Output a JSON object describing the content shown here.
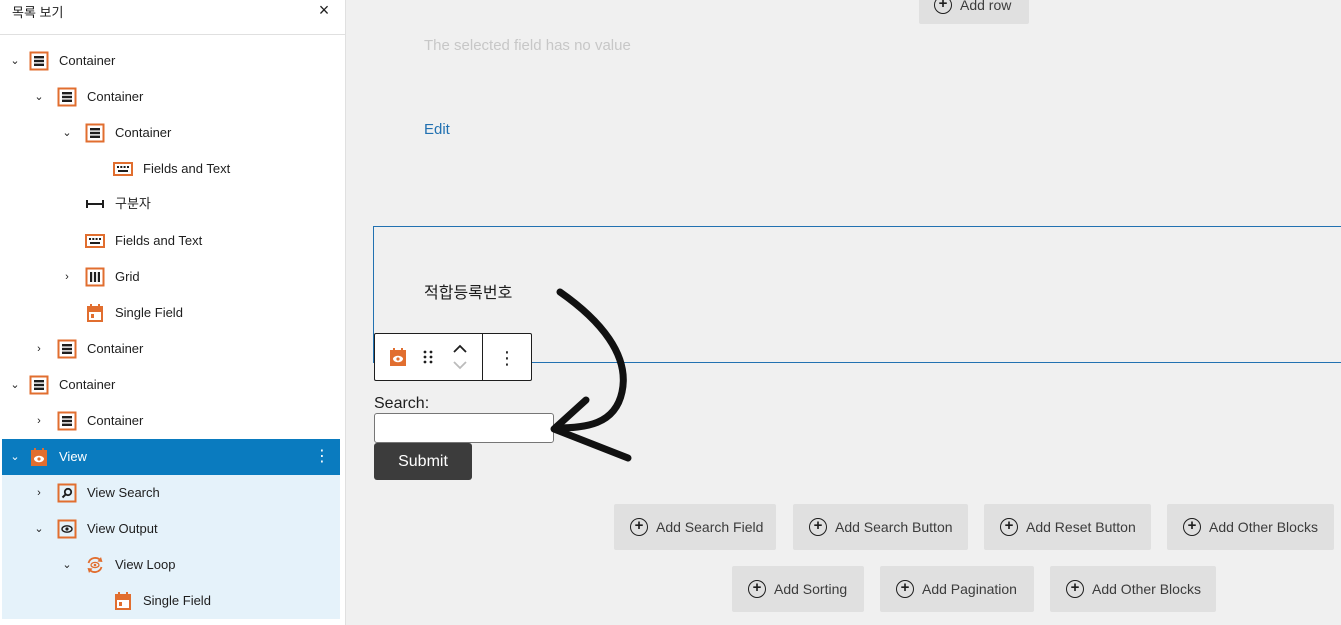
{
  "sidebar": {
    "title": "목록 보기",
    "close_label": "×",
    "items": [
      {
        "label": "Container",
        "icon": "container-icon"
      },
      {
        "label": "Container",
        "icon": "container-icon"
      },
      {
        "label": "Container",
        "icon": "container-icon"
      },
      {
        "label": "Fields and Text",
        "icon": "keyboard-icon"
      },
      {
        "label": "구분자",
        "icon": "separator-icon"
      },
      {
        "label": "Fields and Text",
        "icon": "keyboard-icon"
      },
      {
        "label": "Grid",
        "icon": "grid-icon"
      },
      {
        "label": "Single Field",
        "icon": "calendar-icon"
      },
      {
        "label": "Container",
        "icon": "container-icon"
      },
      {
        "label": "Container",
        "icon": "container-icon"
      },
      {
        "label": "Container",
        "icon": "container-icon"
      },
      {
        "label": "View",
        "icon": "view-icon",
        "selected": true
      },
      {
        "label": "View Search",
        "icon": "search-icon"
      },
      {
        "label": "View Output",
        "icon": "eye-icon"
      },
      {
        "label": "View Loop",
        "icon": "loop-icon"
      },
      {
        "label": "Single Field",
        "icon": "calendar-icon"
      }
    ]
  },
  "main": {
    "add_row_label": "Add row",
    "no_value_text": "The selected field has no value",
    "edit_label": "Edit",
    "block_text": "적합등록번호",
    "search_label": "Search:",
    "search_value": "",
    "submit_label": "Submit",
    "buttons_row1": [
      "Add Search Field",
      "Add Search Button",
      "Add Reset Button",
      "Add Other Blocks"
    ],
    "buttons_row2": [
      "Add Sorting",
      "Add Pagination",
      "Add Other Blocks"
    ]
  },
  "colors": {
    "accent": "#0a7bbf",
    "icon_orange": "#e16e2f",
    "selection_border": "#2271b1",
    "child_selected_bg": "#e5f2fa"
  }
}
